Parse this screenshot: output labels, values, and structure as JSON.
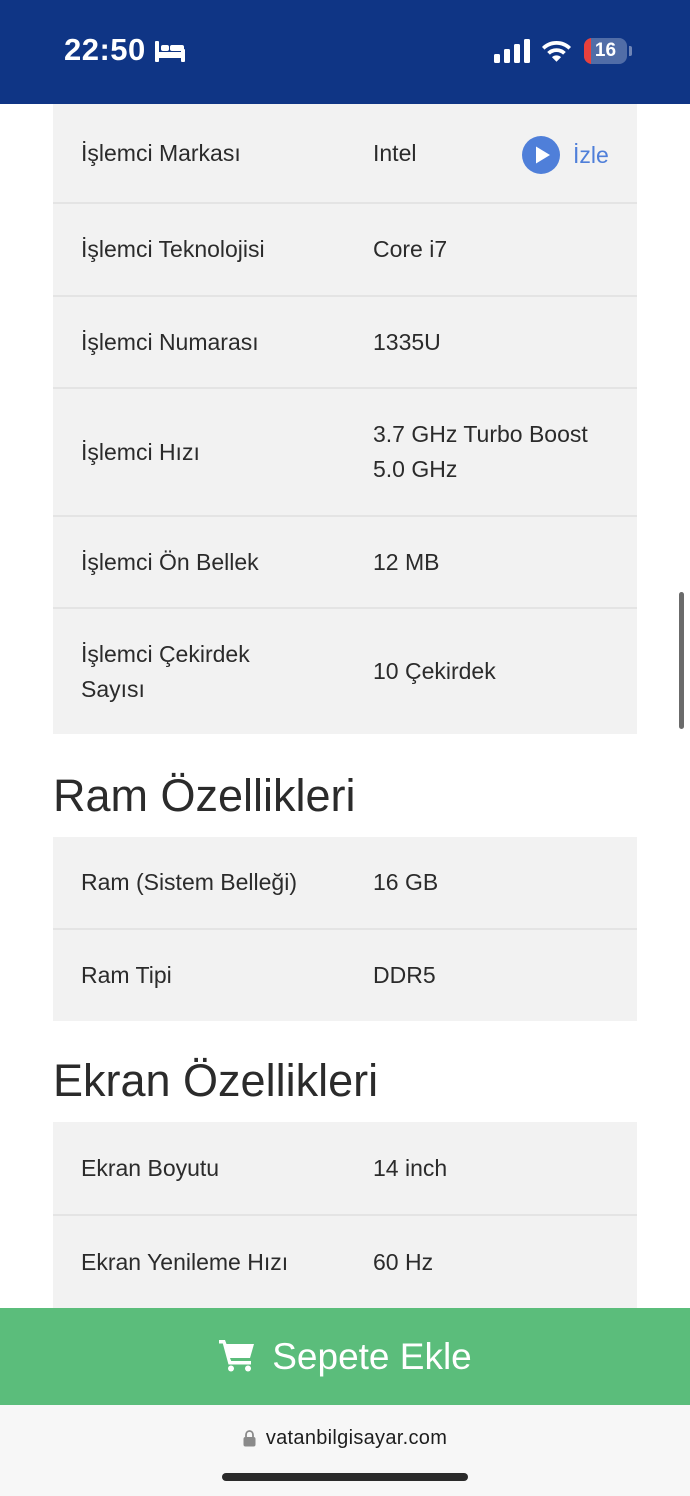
{
  "status_bar": {
    "time": "22:50",
    "battery_level": "16",
    "battery_fraction": 0.16,
    "background_color": "#0f3585",
    "icons": [
      "bed-icon",
      "cellular-signal-icon",
      "wifi-icon",
      "battery-icon"
    ]
  },
  "processor_specs": {
    "rows": [
      {
        "label": "İşlemci Markası",
        "value": "Intel"
      },
      {
        "label": "İşlemci Teknolojisi",
        "value": "Core i7"
      },
      {
        "label": "İşlemci Numarası",
        "value": "1335U"
      },
      {
        "label": "İşlemci Hızı",
        "value": "3.7 GHz Turbo Boost 5.0 GHz"
      },
      {
        "label": "İşlemci Ön Bellek",
        "value": "12 MB"
      },
      {
        "label": "İşlemci Çekirdek Sayısı",
        "value": "10 Çekirdek"
      }
    ],
    "watch_label": "İzle",
    "watch_icon": "play-circle-icon"
  },
  "ram_section": {
    "heading": "Ram Özellikleri",
    "rows": [
      {
        "label": "Ram (Sistem Belleği)",
        "value": "16 GB"
      },
      {
        "label": "Ram Tipi",
        "value": "DDR5"
      }
    ]
  },
  "screen_section": {
    "heading": "Ekran Özellikleri",
    "rows": [
      {
        "label": "Ekran Boyutu",
        "value": "14 inch"
      },
      {
        "label": "Ekran Yenileme Hızı",
        "value": "60 Hz"
      }
    ]
  },
  "cart_button": {
    "label": "Sepete Ekle",
    "icon": "shopping-cart-icon",
    "color": "#5bbd7b"
  },
  "browser": {
    "url": "vatanbilgisayar.com",
    "icon": "lock-icon"
  },
  "colors": {
    "row_background": "#f2f2f2",
    "link_blue": "#4f7fd9"
  }
}
